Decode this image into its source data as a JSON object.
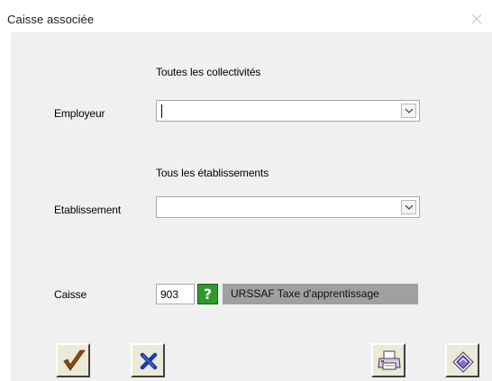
{
  "window": {
    "title": "Caisse associée"
  },
  "employeur": {
    "hint": "Toutes les collectivités",
    "label": "Employeur",
    "value": ""
  },
  "etablissement": {
    "hint": "Tous les établissements",
    "label": "Etablissement",
    "value": ""
  },
  "caisse": {
    "label": "Caisse",
    "code": "903",
    "help_glyph": "?",
    "name": "URSSAF Taxe d'apprentissage"
  },
  "toolbar": {
    "icons": [
      "checkmark-icon",
      "cancel-x-icon",
      "printer-icon",
      "eraser-icon"
    ]
  },
  "colors": {
    "body_bg": "#f0f0f0",
    "help_green": "#2c9a2c",
    "caisse_name_bg": "#a0a0a0",
    "button_face": "#ece9d8",
    "check_color": "#8b4a12",
    "cancel_color": "#1f3aa8"
  }
}
